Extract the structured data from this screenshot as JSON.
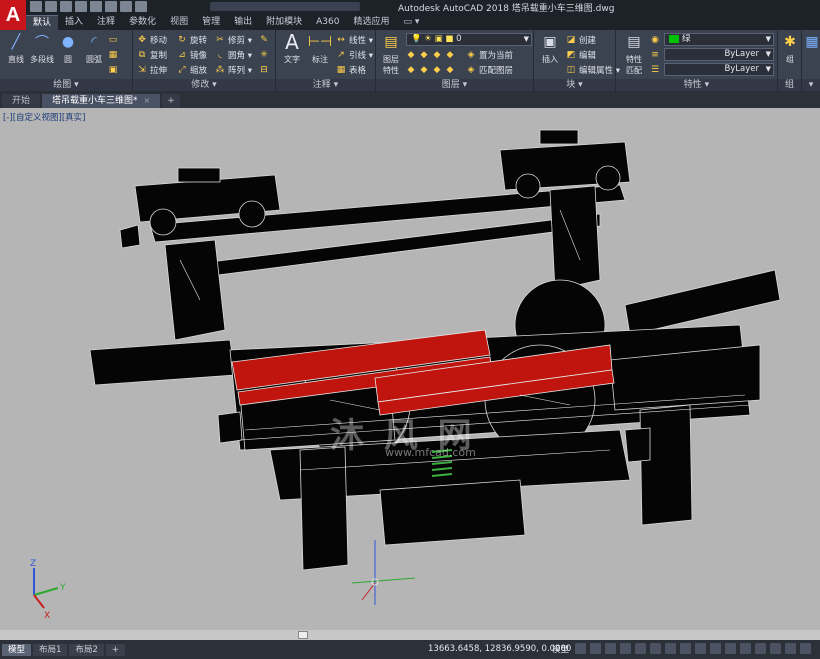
{
  "app": {
    "title": "Autodesk AutoCAD 2018    塔吊载重小车三维图.dwg",
    "logo": "A"
  },
  "ribbon_tabs": [
    "默认",
    "插入",
    "注释",
    "参数化",
    "视图",
    "管理",
    "输出",
    "附加模块",
    "A360",
    "精选应用",
    "▭ ▾"
  ],
  "ribbon": {
    "draw": {
      "title": "绘图 ▾",
      "line": "直线",
      "polyline": "多段线",
      "circle": "圆",
      "arc": "圆弧"
    },
    "modify": {
      "title": "修改 ▾",
      "move": "移动",
      "rotate": "旋转",
      "trim": "修剪 ▾",
      "copy": "复制",
      "mirror": "镜像",
      "fillet": "圆角 ▾",
      "stretch": "拉伸",
      "scale": "缩放",
      "array": "阵列 ▾"
    },
    "annotation": {
      "title": "注释 ▾",
      "text": "文字",
      "dimension": "标注",
      "linear": "线性 ▾",
      "leader": "引线 ▾",
      "table": "表格"
    },
    "layers": {
      "title": "图层 ▾",
      "layer_props": "图层\n特性",
      "current_layer": "0",
      "set_current": "置为当前",
      "match_layer": "匹配图层"
    },
    "block": {
      "title": "块 ▾",
      "insert": "插入",
      "create": "创建",
      "edit": "编辑",
      "edit_attr": "编辑属性 ▾"
    },
    "properties": {
      "title": "特性 ▾",
      "match": "特性\n匹配",
      "color": "绿",
      "color_hex": "#00c000",
      "linetype": "ByLayer",
      "lineweight": "ByLayer"
    },
    "groups": {
      "title": "组",
      "label": "组"
    },
    "utilities": {
      "title": "▾"
    }
  },
  "file_tabs": [
    {
      "label": "开始",
      "active": false
    },
    {
      "label": "塔吊载重小车三维图*",
      "active": true,
      "close": "×"
    }
  ],
  "file_tab_add": "+",
  "viewport": {
    "label": "[-][自定义视图][真实]",
    "watermark": "沐 风 网",
    "watermark_url": "www.mfcad.com",
    "accent_red": "#c0140e",
    "spring_green": "#3cb040"
  },
  "status": {
    "layout_tabs": [
      "模型",
      "布局1",
      "布局2"
    ],
    "add_layout": "+",
    "coordinates": "13663.6458, 12836.9590, 0.0000",
    "space": "模型"
  }
}
